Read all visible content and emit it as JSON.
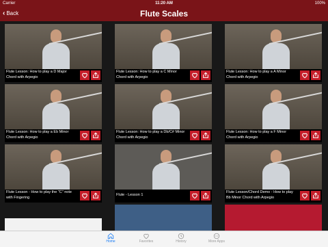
{
  "status": {
    "carrier": "Carrier",
    "time": "11:20 AM",
    "battery": "100%"
  },
  "nav": {
    "back_label": "Back",
    "title": "Flute Scales"
  },
  "videos": [
    {
      "title": "Flute Lesson: How to play a D Major Chord with Arpegio"
    },
    {
      "title": "Flute Lesson: How to play a C Minor Chord with Arpegio"
    },
    {
      "title": "Flute Lesson: How to play a A Minor Chord with Arpegio"
    },
    {
      "title": "Flute Lesson: How to play a Eb Minor Chord with Arpegio"
    },
    {
      "title": "Flute Lesson: How to play a Db/C# Minor Chord with Arpegio"
    },
    {
      "title": "Flute Lesson: How to play a F Minor Chord with Arpegio"
    },
    {
      "title": "Flute Lesson - How to play the \"C\" note with Fingering"
    },
    {
      "title": "Flute - Lesson 1"
    },
    {
      "title": "Flute Lesson/Chord Demo - How to play Bb Minor Chord with Arpegio"
    }
  ],
  "tabs": [
    {
      "label": "Home",
      "icon": "home-icon",
      "active": true
    },
    {
      "label": "Favorites",
      "icon": "heart-icon",
      "active": false
    },
    {
      "label": "History",
      "icon": "clock-icon",
      "active": false
    },
    {
      "label": "More Apps",
      "icon": "more-icon",
      "active": false
    }
  ],
  "colors": {
    "brand": "#7a1418",
    "action": "#c51e2a",
    "tab_active": "#1a7cf4"
  }
}
